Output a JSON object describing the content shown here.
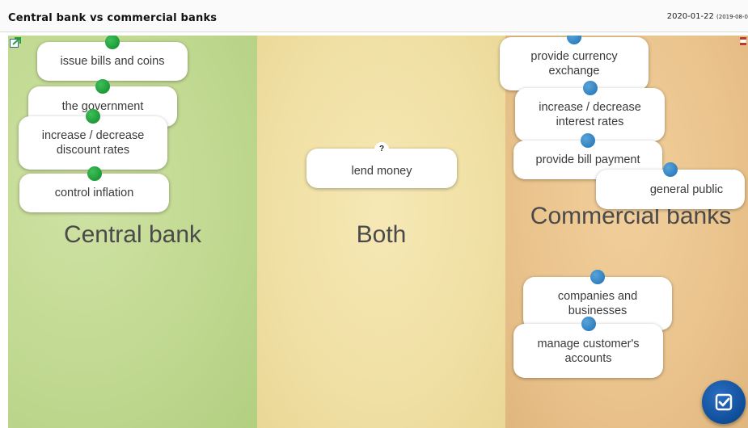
{
  "header": {
    "title": "Central bank vs commercial banks",
    "date": "2020-01-22",
    "date_extra": "(2019-08-0"
  },
  "zones": {
    "central": {
      "label": "Central bank",
      "color": "#c5dc95"
    },
    "both": {
      "label": "Both",
      "color": "#f2e3aa"
    },
    "commercial": {
      "label": "Commercial banks",
      "color": "#ecc690"
    }
  },
  "cards": {
    "issue_bills": "issue bills and coins",
    "government": "the government",
    "discount_rates": "increase / decrease discount rates",
    "control_inflation": "control inflation",
    "lend_money": "lend money",
    "lend_money_marker": "?",
    "currency_exchange": "provide currency exchange",
    "interest_rates": "increase / decrease interest rates",
    "bill_payment": "provide bill payment",
    "general_public": "general public",
    "companies": "companies and businesses",
    "customer_accounts": "manage customer's accounts"
  },
  "colors": {
    "pin_central": "#1c9a37",
    "pin_commercial": "#2f80c0",
    "check_button": "#0f4d99"
  },
  "icons": {
    "help": "help-icon",
    "flag": "flag-icon",
    "check": "check-icon"
  }
}
